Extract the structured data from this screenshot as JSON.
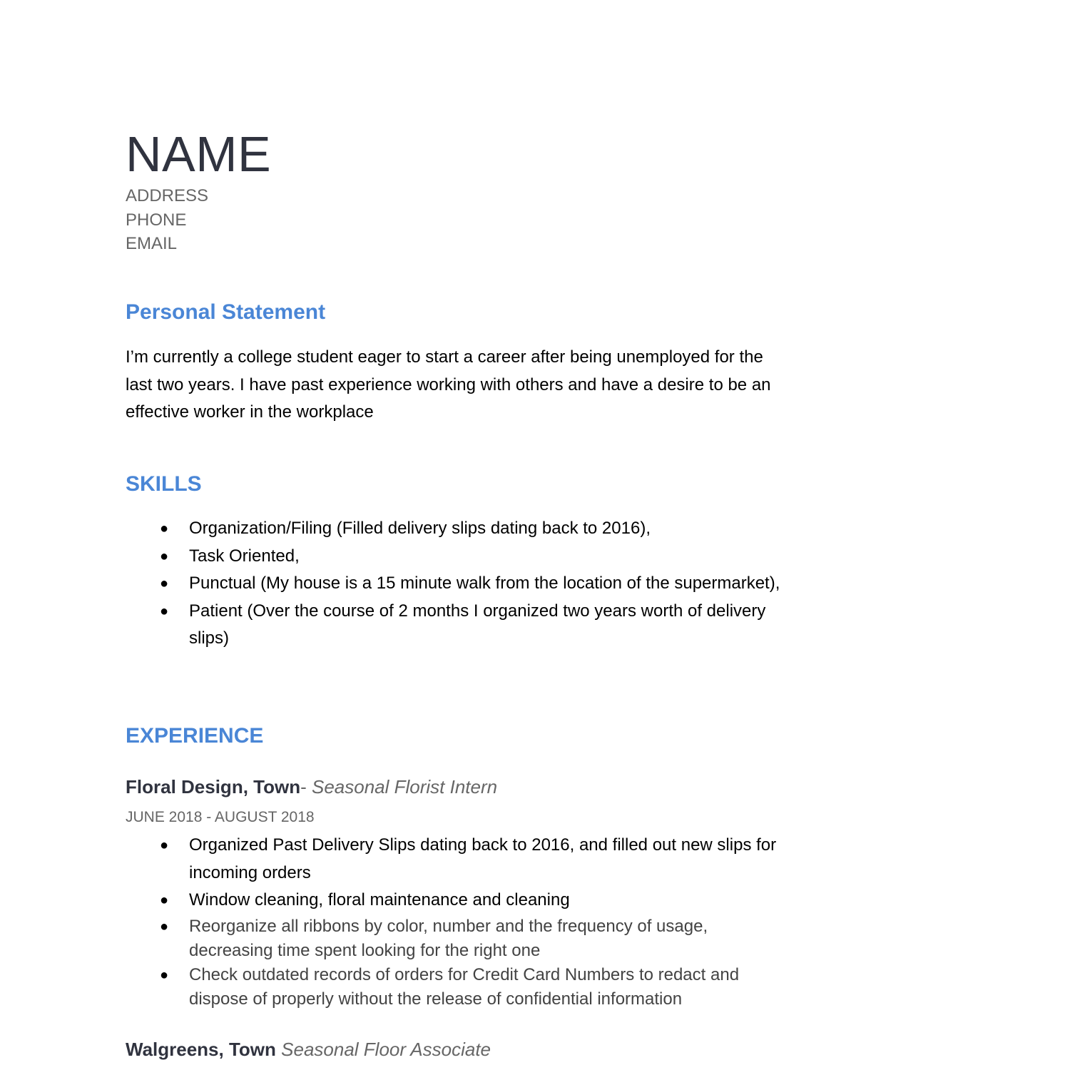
{
  "header": {
    "name": "NAME",
    "address": "ADDRESS",
    "phone": "PHONE",
    "email": "EMAIL"
  },
  "colors": {
    "accent": "#4a86d6",
    "heading_dark": "#30333f",
    "muted": "#666666",
    "body": "#000000"
  },
  "personal_statement": {
    "title": "Personal Statement",
    "text": "I’m currently a college student eager to start a career after being unemployed for the last two years. I have past experience working with others and have a desire to be an effective worker in the workplace"
  },
  "skills": {
    "title": "SKILLS",
    "bullet_symbol": "●",
    "items": [
      "Organization/Filing (Filled delivery slips dating back to 2016),",
      "Task Oriented,",
      "Punctual (My house is a 15 minute walk from the location of the supermarket),",
      "Patient (Over the course of 2 months I organized two years worth of delivery slips)"
    ]
  },
  "experience": {
    "title": "EXPERIENCE",
    "jobs": [
      {
        "company": "Floral Design,  Town",
        "separator": "- ",
        "role": "Seasonal Florist Intern",
        "dates": "JUNE 2018 - AUGUST 2018",
        "bullets": [
          "Organized Past Delivery Slips dating back to 2016, and filled out new slips for incoming orders",
          "Window cleaning, floral maintenance and cleaning",
          "Reorganize all ribbons by color, number and the frequency of usage, decreasing time spent looking for the right one",
          "Check outdated records of orders for Credit Card Numbers to redact and dispose of properly without the release of confidential information"
        ]
      },
      {
        "company": "Walgreens,  Town",
        "separator": " ",
        "role": "Seasonal Floor Associate"
      }
    ]
  }
}
